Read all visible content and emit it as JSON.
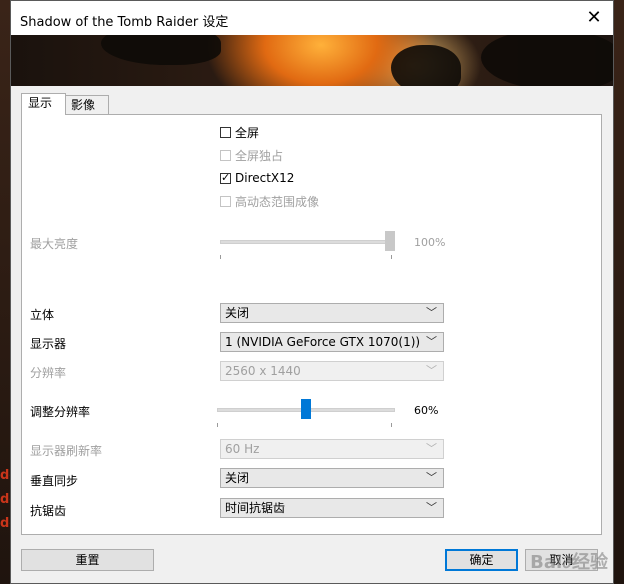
{
  "window": {
    "title": "Shadow of the Tomb Raider 设定"
  },
  "tabs": [
    {
      "label": "显示"
    },
    {
      "label": "影像"
    }
  ],
  "checkboxes": {
    "fullscreen": {
      "label": "全屏",
      "checked": false,
      "enabled": true
    },
    "exclusive_fullscreen": {
      "label": "全屏独占",
      "checked": false,
      "enabled": false
    },
    "directx12": {
      "label": "DirectX12",
      "checked": true,
      "enabled": true
    },
    "hdr": {
      "label": "高动态范围成像",
      "checked": false,
      "enabled": false
    }
  },
  "max_brightness": {
    "label": "最大亮度",
    "value_text": "100%",
    "value": 1.0,
    "enabled": false
  },
  "stereo": {
    "label": "立体",
    "value": "关闭"
  },
  "monitor": {
    "label": "显示器",
    "value": "1 (NVIDIA GeForce GTX 1070(1))"
  },
  "resolution": {
    "label": "分辨率",
    "value": "2560 x 1440",
    "enabled": false
  },
  "resolution_scale": {
    "label": "调整分辨率",
    "value_text": "60%",
    "value": 0.5
  },
  "refresh_rate": {
    "label": "显示器刷新率",
    "value": "60 Hz",
    "enabled": false
  },
  "vsync": {
    "label": "垂直同步",
    "value": "关闭"
  },
  "antialiasing": {
    "label": "抗锯齿",
    "value": "时间抗锯齿"
  },
  "buttons": {
    "reset": "重置",
    "ok": "确定",
    "cancel": "取消"
  },
  "icons": {
    "close": "close-icon",
    "chevron": "chevron-down-icon",
    "check": "checkmark-icon"
  },
  "colors": {
    "accent": "#0078d7",
    "disabled_text": "#a0a0a0"
  }
}
